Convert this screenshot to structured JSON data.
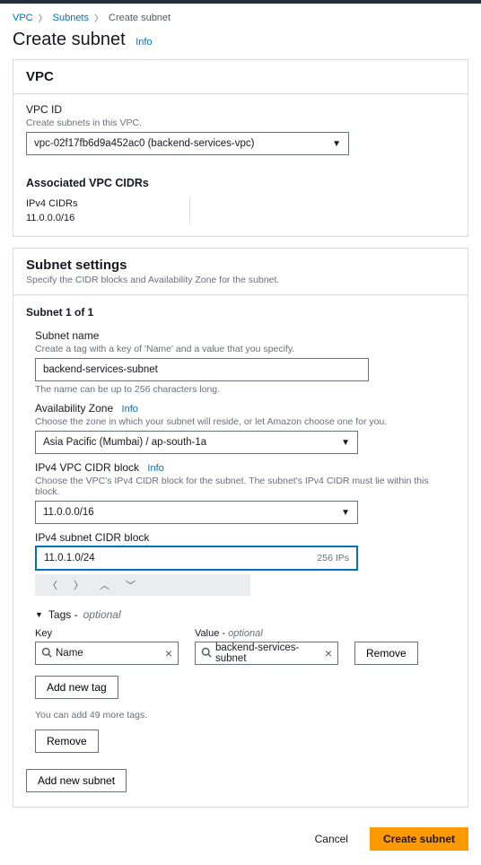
{
  "breadcrumbs": {
    "vpc": "VPC",
    "subnets": "Subnets",
    "current": "Create subnet"
  },
  "page": {
    "title": "Create subnet",
    "info": "Info"
  },
  "vpc_panel": {
    "title": "VPC",
    "id_label": "VPC ID",
    "id_sub": "Create subnets in this VPC.",
    "vpc_selected": "vpc-02f17fb6d9a452ac0 (backend-services-vpc)",
    "assoc_title": "Associated VPC CIDRs",
    "ipv4_label": "IPv4 CIDRs",
    "ipv4_value": "11.0.0.0/16"
  },
  "subnet_panel": {
    "title": "Subnet settings",
    "desc": "Specify the CIDR blocks and Availability Zone for the subnet.",
    "index": "Subnet 1 of 1",
    "name_label": "Subnet name",
    "name_sub": "Create a tag with a key of 'Name' and a value that you specify.",
    "name_value": "backend-services-subnet",
    "name_help": "The name can be up to 256 characters long.",
    "az_label": "Availability Zone",
    "az_info": "Info",
    "az_sub": "Choose the zone in which your subnet will reside, or let Amazon choose one for you.",
    "az_value": "Asia Pacific (Mumbai) / ap-south-1a",
    "vpc_cidr_label": "IPv4 VPC CIDR block",
    "vpc_cidr_info": "Info",
    "vpc_cidr_sub": "Choose the VPC's IPv4 CIDR block for the subnet. The subnet's IPv4 CIDR must lie within this block.",
    "vpc_cidr_value": "11.0.0.0/16",
    "subnet_cidr_label": "IPv4 subnet CIDR block",
    "subnet_cidr_value": "11.0.1.0/24",
    "subnet_cidr_hint": "256 IPs",
    "tags_label": "Tags -",
    "tags_optional": "optional",
    "key_label": "Key",
    "value_label": "Value -",
    "value_optional": "optional",
    "tag_key_value": "Name",
    "tag_value_value": "backend-services-subnet",
    "remove": "Remove",
    "add_tag": "Add new tag",
    "more_tags": "You can add 49 more tags.",
    "remove_subnet": "Remove",
    "add_subnet": "Add new subnet"
  },
  "footer": {
    "cancel": "Cancel",
    "create": "Create subnet"
  }
}
